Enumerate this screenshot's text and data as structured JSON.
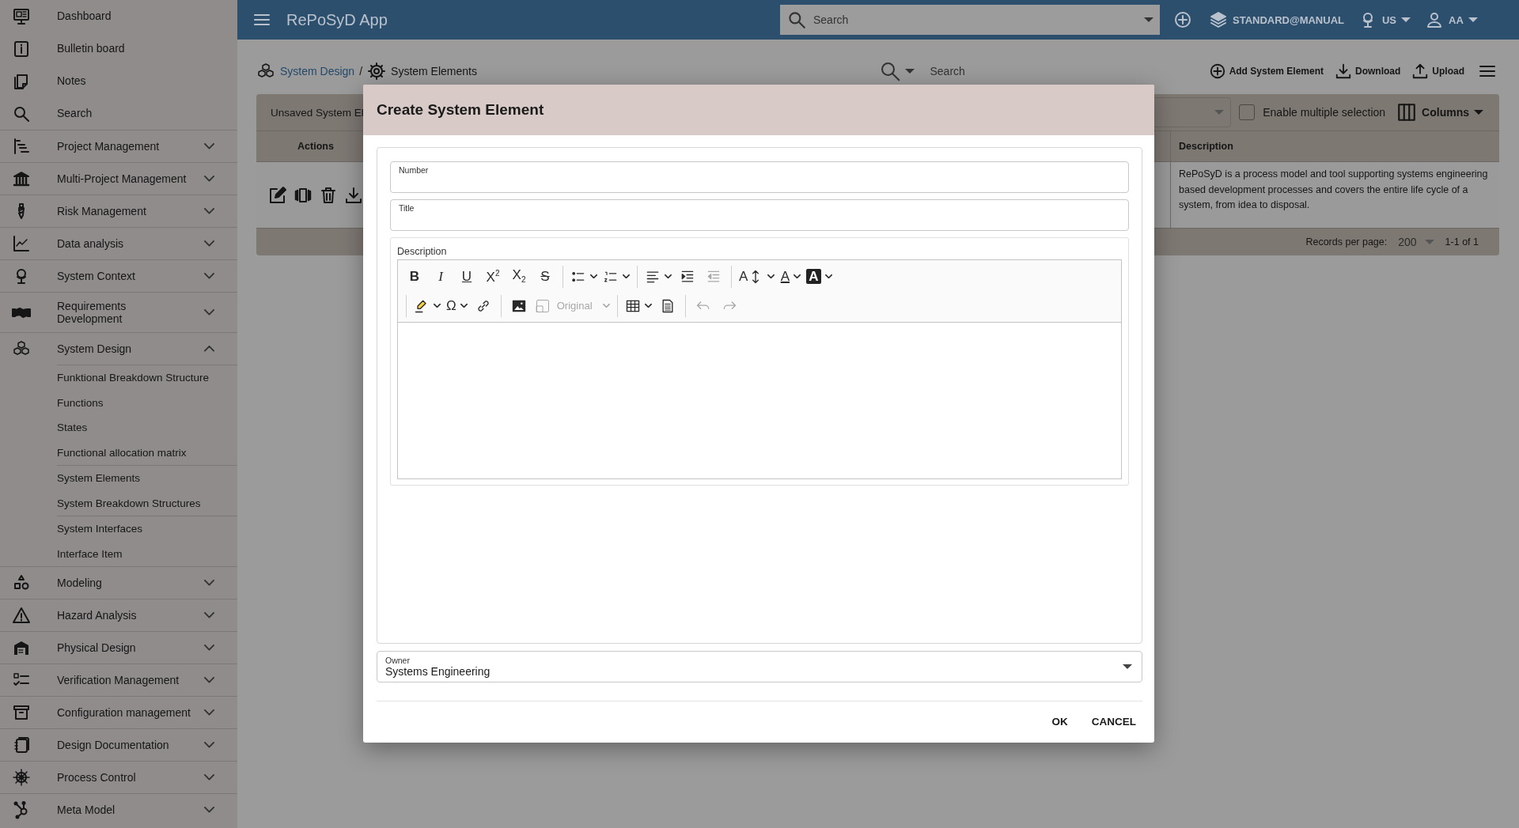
{
  "topbar": {
    "title": "RePoSyD App",
    "search": {
      "placeholder": "Search"
    },
    "profile": "STANDARD@MANUAL",
    "language": "US",
    "user": "AA"
  },
  "sidebar": {
    "top_items": [
      {
        "label": "Dashboard"
      },
      {
        "label": "Bulletin board"
      },
      {
        "label": "Notes"
      },
      {
        "label": "Search"
      }
    ],
    "sections": [
      {
        "label": "Project Management",
        "expanded": false
      },
      {
        "label": "Multi-Project Management",
        "expanded": false
      },
      {
        "label": "Risk Management",
        "expanded": false
      },
      {
        "label": "Data analysis",
        "expanded": false
      },
      {
        "label": "System Context",
        "expanded": false
      },
      {
        "label": "Requirements\nDevelopment",
        "expanded": false
      },
      {
        "label": "System Design",
        "expanded": true,
        "child_groups": [
          [
            {
              "label": "Funktional Breakdown Structure"
            },
            {
              "label": "Functions"
            },
            {
              "label": "States"
            },
            {
              "label": "Functional allocation matrix"
            }
          ],
          [
            {
              "label": "System Elements"
            },
            {
              "label": "System Breakdown Structures"
            }
          ],
          [
            {
              "label": "System Interfaces"
            },
            {
              "label": "Interface Item"
            }
          ]
        ]
      },
      {
        "label": "Modeling",
        "expanded": false
      },
      {
        "label": "Hazard Analysis",
        "expanded": false
      },
      {
        "label": "Physical Design",
        "expanded": false
      },
      {
        "label": "Verification Management",
        "expanded": false
      },
      {
        "label": "Configuration management",
        "expanded": false
      },
      {
        "label": "Design Documentation",
        "expanded": false
      },
      {
        "label": "Process Control",
        "expanded": false
      },
      {
        "label": "Meta Model",
        "expanded": false
      }
    ]
  },
  "breadcrumb": [
    {
      "label": "System Design",
      "kind": "link"
    },
    {
      "label": "/",
      "kind": "separator"
    },
    {
      "label": "System Elements",
      "kind": "current"
    }
  ],
  "page_search": {
    "placeholder": "Search"
  },
  "page_actions": [
    {
      "label": "Add System Element"
    },
    {
      "label": "Download"
    },
    {
      "label": "Upload"
    }
  ],
  "table": {
    "title": "Unsaved System El",
    "multi_select": {
      "label": "Enable multiple selection",
      "checked": false
    },
    "columns_button": "Columns",
    "columns": [
      "Actions",
      "Description"
    ],
    "rows": [
      {
        "description": "RePoSyD is a process model and tool supporting systems engineering based development processes and covers the entire life cycle of a system, from idea to disposal."
      }
    ],
    "records_label": "Records per page:",
    "records_value": "200",
    "range": "1-1 of 1"
  },
  "dialog": {
    "title": "Create System Element",
    "fields": [
      {
        "label": "Number"
      },
      {
        "label": "Title"
      }
    ],
    "description": {
      "label": "Description",
      "toolbar_rows": [
        [
          [
            {
              "kind": "bold",
              "glyph": "B",
              "dropdown": false,
              "disabled": false
            },
            {
              "kind": "italic",
              "glyph": "I",
              "dropdown": false,
              "disabled": false
            },
            {
              "kind": "underline",
              "glyph": "U",
              "dropdown": false,
              "disabled": false
            },
            {
              "kind": "superscript",
              "glyph": "X$^{2}$",
              "dropdown": false,
              "disabled": false
            },
            {
              "kind": "subscript",
              "glyph": "X$_{2}$",
              "dropdown": false,
              "disabled": false
            },
            {
              "kind": "strike",
              "glyph": "S",
              "dropdown": false,
              "disabled": false
            }
          ],
          [
            {
              "kind": "icon",
              "dropdown": true,
              "disabled": false
            },
            {
              "kind": "icon",
              "dropdown": true,
              "disabled": false
            }
          ],
          [
            {
              "kind": "icon",
              "dropdown": true,
              "disabled": false
            },
            {
              "kind": "icon",
              "dropdown": false,
              "disabled": false
            },
            {
              "kind": "icon",
              "dropdown": false,
              "disabled": true
            }
          ],
          [
            {
              "kind": "font-size",
              "glyph": "A",
              "dropdown": true,
              "disabled": false
            },
            {
              "kind": "font-color",
              "glyph": "A",
              "dropdown": true,
              "disabled": false
            },
            {
              "kind": "bg-color",
              "glyph": "A",
              "dropdown": true,
              "disabled": false
            }
          ]
        ],
        [
          [
            {
              "kind": "icon",
              "dropdown": true,
              "disabled": false
            },
            {
              "kind": "glyph",
              "glyph": "Ω",
              "dropdown": true,
              "disabled": false
            },
            {
              "kind": "icon",
              "dropdown": false,
              "disabled": false
            }
          ],
          [
            {
              "kind": "icon",
              "dropdown": false,
              "disabled": false
            },
            {
              "kind": "image-size",
              "label": "Original",
              "dropdown": true,
              "disabled": true
            }
          ],
          [
            {
              "kind": "icon",
              "dropdown": true,
              "disabled": false
            },
            {
              "kind": "icon",
              "dropdown": false,
              "disabled": false
            }
          ],
          [
            {
              "kind": "icon",
              "dropdown": false,
              "disabled": true
            },
            {
              "kind": "icon",
              "dropdown": false,
              "disabled": true
            }
          ]
        ]
      ]
    },
    "owner": {
      "label": "Owner",
      "value": "Systems Engineering"
    },
    "buttons": [
      "OK",
      "CANCEL"
    ]
  }
}
